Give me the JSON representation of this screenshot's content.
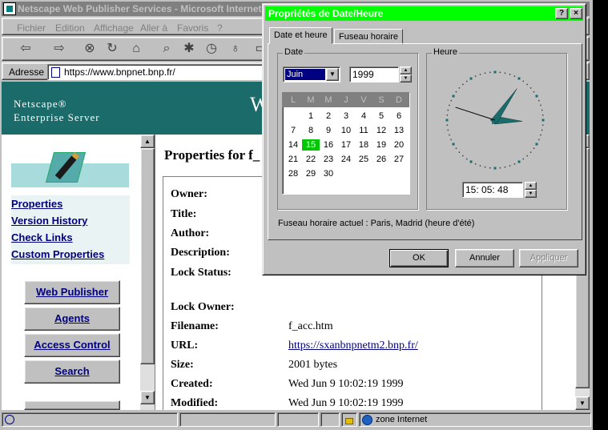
{
  "browser": {
    "title": "Netscape Web Publisher Services - Microsoft Internet",
    "menu": [
      "Fichier",
      "Edition",
      "Affichage",
      "Aller à",
      "Favoris",
      "?"
    ],
    "address_label": "Adresse",
    "address_value": "https://www.bnpnet.bnp.fr/"
  },
  "banner": {
    "line1": "Netscape®",
    "line2": "Enterprise Server",
    "partial_title": "W"
  },
  "left_nav": {
    "links": [
      "Properties",
      "Version History",
      "Check Links",
      "Custom Properties"
    ],
    "buttons": [
      "Web Publisher",
      "Agents",
      "Access Control",
      "Search"
    ]
  },
  "properties": {
    "heading": "Properties for f_",
    "rows": [
      {
        "label": "Owner:",
        "value": ""
      },
      {
        "label": "Title:",
        "value": ""
      },
      {
        "label": "Author:",
        "value": ""
      },
      {
        "label": "Description:",
        "value": ""
      },
      {
        "label": "Lock Status:",
        "value": ""
      },
      {
        "label": "Lock Owner:",
        "value": ""
      },
      {
        "label": "Filename:",
        "value": "f_acc.htm"
      },
      {
        "label": "URL:",
        "value": "https://sxanbnpnetm2.bnp.fr/"
      },
      {
        "label": "Size:",
        "value": "2001 bytes"
      },
      {
        "label": "Created:",
        "value": "Wed Jun 9 10:02:19 1999"
      },
      {
        "label": "Modified:",
        "value": "Wed Jun 9 10:02:19 1999"
      }
    ]
  },
  "statusbar": {
    "zone": "zone Internet"
  },
  "dialog": {
    "title": "Propriétés de Date/Heure",
    "help": "?",
    "close": "×",
    "tabs": [
      "Date et heure",
      "Fuseau horaire"
    ],
    "date_group": "Date",
    "time_group": "Heure",
    "month": "Juin",
    "year": "1999",
    "weekdays": [
      "L",
      "M",
      "M",
      "J",
      "V",
      "S",
      "D"
    ],
    "days": [
      "1",
      "2",
      "3",
      "4",
      "5",
      "6",
      "7",
      "8",
      "9",
      "10",
      "11",
      "12",
      "13",
      "14",
      "15",
      "16",
      "17",
      "18",
      "19",
      "20",
      "21",
      "22",
      "23",
      "24",
      "25",
      "26",
      "27",
      "28",
      "29",
      "30"
    ],
    "first_weekday_index": 1,
    "selected_day": "15",
    "time": "15: 05: 48",
    "clock": {
      "hour": 15,
      "minute": 5,
      "second": 48
    },
    "timezone": "Fuseau horaire actuel : Paris, Madrid (heure d'été)",
    "buttons": {
      "ok": "OK",
      "cancel": "Annuler",
      "apply": "Appliquer"
    },
    "colors": {
      "title_bar": "#00ff00",
      "selected_day": "#00c800",
      "clock_hand": "#1b6b6b"
    }
  }
}
